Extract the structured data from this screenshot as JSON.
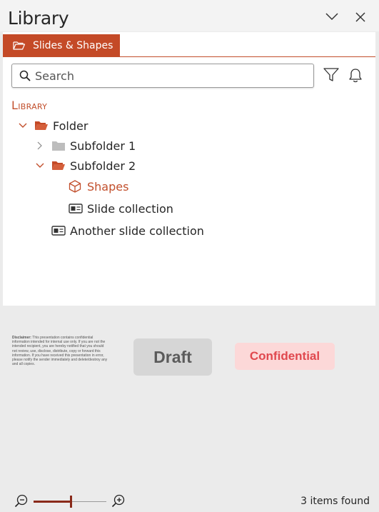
{
  "window": {
    "title": "Library"
  },
  "tabs": [
    {
      "label": "Slides & Shapes",
      "active": true
    }
  ],
  "search": {
    "placeholder": "Search",
    "value": ""
  },
  "library": {
    "heading": "Library",
    "tree": [
      {
        "label": "Folder",
        "icon": "folder-open-icon",
        "expanded": true,
        "level": 0
      },
      {
        "label": "Subfolder 1",
        "icon": "folder-icon",
        "expanded": false,
        "level": 1
      },
      {
        "label": "Subfolder 2",
        "icon": "folder-open-icon",
        "expanded": true,
        "level": 1
      },
      {
        "label": "Shapes",
        "icon": "cube-icon",
        "level": 2,
        "selected": true
      },
      {
        "label": "Slide collection",
        "icon": "slide-collection-icon",
        "level": 2
      },
      {
        "label": "Another slide collection",
        "icon": "slide-collection-icon",
        "level": 1
      }
    ]
  },
  "preview": {
    "disclaimer_title": "Disclaimer:",
    "disclaimer_text": "This presentation contains confidential information intended for internal use only. If you are not the intended recipient, you are hereby notified that you should not review, use, disclose, distribute, copy or forward this information. If you have received this presentation in error, please notify the sender immediately and delete/destroy any and all copies.",
    "draft_label": "Draft",
    "confidential_label": "Confidential"
  },
  "status": {
    "items_found": "3 items found",
    "zoom_level": 0.5
  },
  "colors": {
    "accent": "#c44a27",
    "confidential_bg": "#fcd8d8",
    "confidential_text": "#e0484e",
    "draft_bg": "#d6d6d6"
  }
}
